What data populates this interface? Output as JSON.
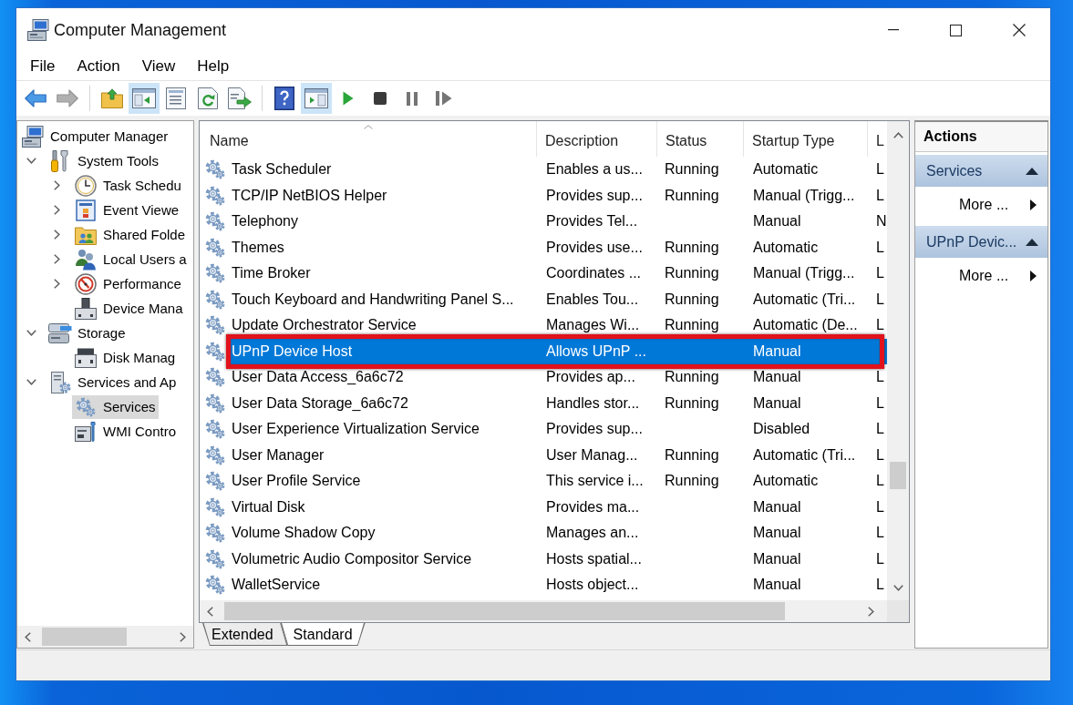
{
  "window": {
    "title": "Computer Management"
  },
  "menu": [
    "File",
    "Action",
    "View",
    "Help"
  ],
  "toolbar": [
    [
      {
        "pressed": false,
        "disabled": false
      },
      {
        "pressed": false,
        "disabled": true
      }
    ],
    [
      {
        "pressed": false,
        "disabled": false
      },
      {
        "pressed": true,
        "disabled": false
      },
      {
        "pressed": false,
        "disabled": false
      },
      {
        "pressed": false,
        "disabled": false
      },
      {
        "pressed": false,
        "disabled": false
      }
    ],
    [
      {
        "pressed": false,
        "disabled": false
      },
      {
        "pressed": true,
        "disabled": false
      },
      {
        "pressed": false,
        "disabled": false
      },
      {
        "pressed": false,
        "disabled": false
      },
      {
        "pressed": false,
        "disabled": true
      },
      {
        "pressed": false,
        "disabled": true
      }
    ]
  ],
  "tree": [
    {
      "label": "Computer Manager",
      "kind": "root",
      "selected": false,
      "children": [
        {
          "label": "System Tools",
          "kind": "branch",
          "expanded": true,
          "selected": false,
          "children": [
            {
              "label": "Task Schedu",
              "kind": "branch",
              "expanded": false,
              "selected": false
            },
            {
              "label": "Event Viewe",
              "kind": "branch",
              "expanded": false,
              "selected": false
            },
            {
              "label": "Shared Folde",
              "kind": "branch",
              "expanded": false,
              "selected": false
            },
            {
              "label": "Local Users a",
              "kind": "branch",
              "expanded": false,
              "selected": false
            },
            {
              "label": "Performance",
              "kind": "branch",
              "expanded": false,
              "selected": false
            },
            {
              "label": "Device Mana",
              "kind": "leaf",
              "selected": false
            }
          ]
        },
        {
          "label": "Storage",
          "kind": "branch",
          "expanded": true,
          "selected": false,
          "children": [
            {
              "label": "Disk Manag",
              "kind": "leaf",
              "selected": false
            }
          ]
        },
        {
          "label": "Services and Ap",
          "kind": "branch",
          "expanded": true,
          "selected": false,
          "children": [
            {
              "label": "Services",
              "kind": "leaf",
              "selected": true
            },
            {
              "label": "WMI Contro",
              "kind": "leaf",
              "selected": false
            }
          ]
        }
      ]
    }
  ],
  "table": {
    "columns": [
      {
        "label": "Name",
        "sorted": true
      },
      {
        "label": "Description",
        "sorted": false
      },
      {
        "label": "Status",
        "sorted": false
      },
      {
        "label": "Startup Type",
        "sorted": false
      },
      {
        "label": "L",
        "sorted": false
      }
    ],
    "rows": [
      {
        "name": "Task Scheduler",
        "description": "Enables a us...",
        "status": "Running",
        "startup_type": "Automatic",
        "column_5": "L",
        "selected": false,
        "outlined": false
      },
      {
        "name": "TCP/IP NetBIOS Helper",
        "description": "Provides sup...",
        "status": "Running",
        "startup_type": "Manual (Trigg...",
        "column_5": "L",
        "selected": false,
        "outlined": false
      },
      {
        "name": "Telephony",
        "description": "Provides Tel...",
        "startup_type": "Manual",
        "column_5": "N",
        "selected": false,
        "outlined": false
      },
      {
        "name": "Themes",
        "description": "Provides use...",
        "status": "Running",
        "startup_type": "Automatic",
        "column_5": "L",
        "selected": false,
        "outlined": false
      },
      {
        "name": "Time Broker",
        "description": "Coordinates ...",
        "status": "Running",
        "startup_type": "Manual (Trigg...",
        "column_5": "L",
        "selected": false,
        "outlined": false
      },
      {
        "name": "Touch Keyboard and Handwriting Panel S...",
        "description": "Enables Tou...",
        "status": "Running",
        "startup_type": "Automatic (Tri...",
        "column_5": "L",
        "selected": false,
        "outlined": false
      },
      {
        "name": "Update Orchestrator Service",
        "description": "Manages Wi...",
        "status": "Running",
        "startup_type": "Automatic (De...",
        "column_5": "L",
        "selected": false,
        "outlined": false
      },
      {
        "name": "UPnP Device Host",
        "description": "Allows UPnP ...",
        "startup_type": "Manual",
        "selected": true,
        "outlined": true
      },
      {
        "name": "User Data Access_6a6c72",
        "description": "Provides ap...",
        "status": "Running",
        "startup_type": "Manual",
        "column_5": "L",
        "selected": false,
        "outlined": false
      },
      {
        "name": "User Data Storage_6a6c72",
        "description": "Handles stor...",
        "status": "Running",
        "startup_type": "Manual",
        "column_5": "L",
        "selected": false,
        "outlined": false
      },
      {
        "name": "User Experience Virtualization Service",
        "description": "Provides sup...",
        "startup_type": "Disabled",
        "column_5": "L",
        "selected": false,
        "outlined": false
      },
      {
        "name": "User Manager",
        "description": "User Manag...",
        "status": "Running",
        "startup_type": "Automatic (Tri...",
        "column_5": "L",
        "selected": false,
        "outlined": false
      },
      {
        "name": "User Profile Service",
        "description": "This service i...",
        "status": "Running",
        "startup_type": "Automatic",
        "column_5": "L",
        "selected": false,
        "outlined": false
      },
      {
        "name": "Virtual Disk",
        "description": "Provides ma...",
        "startup_type": "Manual",
        "column_5": "L",
        "selected": false,
        "outlined": false
      },
      {
        "name": "Volume Shadow Copy",
        "description": "Manages an...",
        "startup_type": "Manual",
        "column_5": "L",
        "selected": false,
        "outlined": false
      },
      {
        "name": "Volumetric Audio Compositor Service",
        "description": "Hosts spatial...",
        "startup_type": "Manual",
        "column_5": "L",
        "selected": false,
        "outlined": false
      },
      {
        "name": "WalletService",
        "description": "Hosts object...",
        "startup_type": "Manual",
        "column_5": "L",
        "selected": false,
        "outlined": false
      }
    ]
  },
  "view_tabs": [
    {
      "label": "Extended",
      "selected": false
    },
    {
      "label": "Standard",
      "selected": true
    }
  ],
  "actions": {
    "title": "Actions",
    "sections": [
      {
        "title": "Services",
        "expanded": true,
        "items": [
          {
            "label": "More ...",
            "submenu": true
          }
        ]
      },
      {
        "title": "UPnP Devic...",
        "expanded": true,
        "items": [
          {
            "label": "More ...",
            "submenu": true
          }
        ]
      }
    ]
  }
}
